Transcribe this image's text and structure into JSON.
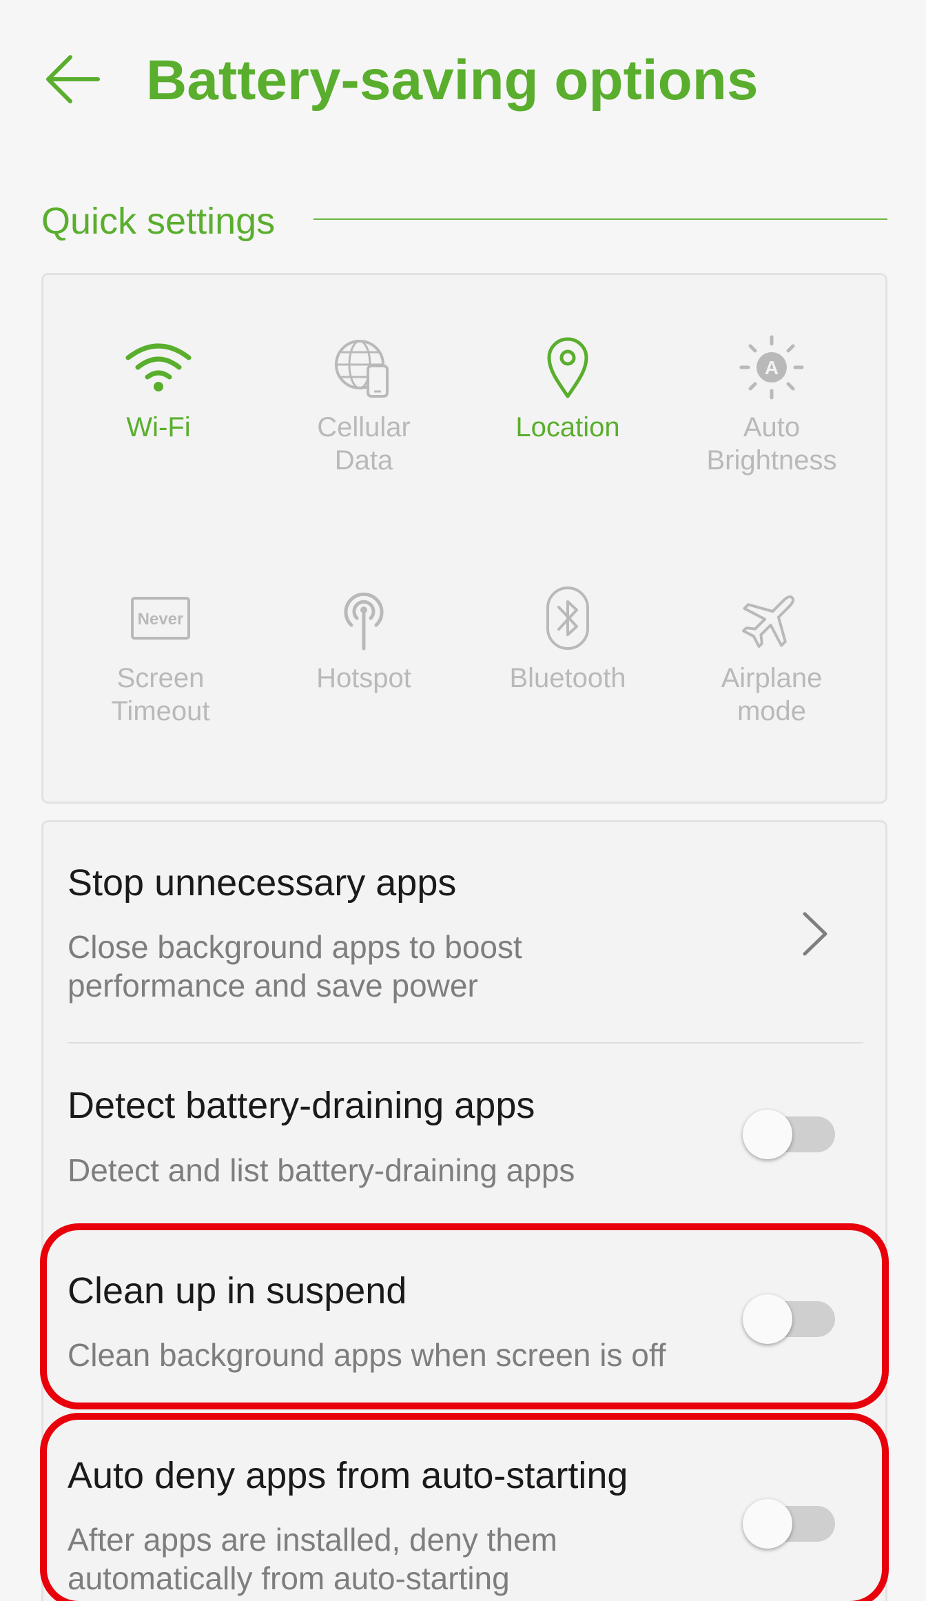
{
  "header": {
    "back_icon": "arrow-left-icon",
    "title": "Battery-saving options"
  },
  "quick_settings": {
    "section_title": "Quick settings",
    "tiles": [
      {
        "label": "Wi-Fi",
        "icon": "wifi-icon",
        "state": "on"
      },
      {
        "label": "Cellular\nData",
        "icon": "globe-phone-icon",
        "state": "off"
      },
      {
        "label": "Location",
        "icon": "location-pin-icon",
        "state": "on"
      },
      {
        "label": "Auto\nBrightness",
        "icon": "auto-brightness-icon",
        "state": "off"
      },
      {
        "label": "Screen\nTimeout",
        "icon": "screen-timeout-icon",
        "icon_text": "Never",
        "state": "off"
      },
      {
        "label": "Hotspot",
        "icon": "hotspot-icon",
        "state": "off"
      },
      {
        "label": "Bluetooth",
        "icon": "bluetooth-icon",
        "state": "off"
      },
      {
        "label": "Airplane\nmode",
        "icon": "airplane-icon",
        "state": "off"
      }
    ]
  },
  "options": [
    {
      "title": "Stop unnecessary apps",
      "description": "Close background apps to boost\nperformance and save power",
      "control": "chevron-right-icon"
    },
    {
      "title": "Detect battery-draining apps",
      "description": "Detect and list battery-draining apps",
      "control": "toggle",
      "enabled": false
    },
    {
      "title": "Clean up in suspend",
      "description": "Clean background apps when screen is off",
      "control": "toggle",
      "enabled": false
    },
    {
      "title": "Auto deny apps from auto-starting",
      "description": "After apps are installed, deny them\nautomatically from auto-starting",
      "control": "toggle",
      "enabled": false
    }
  ],
  "colors": {
    "accent": "#5aae2e",
    "inactive": "#b9b9b9",
    "highlight": "#e8000b",
    "background": "#f6f6f6"
  }
}
